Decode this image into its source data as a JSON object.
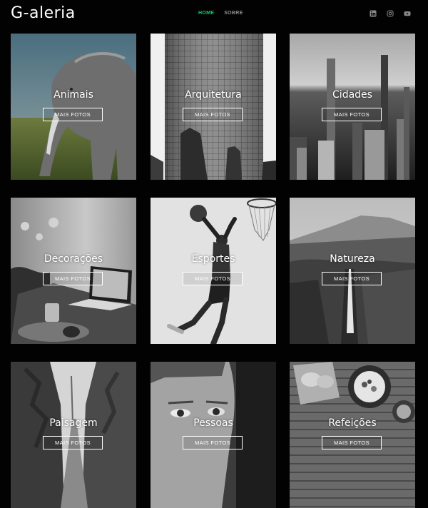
{
  "header": {
    "logo": "G-aleria",
    "nav": [
      {
        "label": "HOME",
        "active": true
      },
      {
        "label": "SOBRE",
        "active": false
      }
    ],
    "social_icons": [
      "linkedin-icon",
      "instagram-icon",
      "youtube-icon"
    ]
  },
  "gallery": {
    "button_label": "MAIS FOTOS",
    "categories": [
      {
        "title": "Animais",
        "image": "elephant-photo"
      },
      {
        "title": "Arquitetura",
        "image": "glass-building-photo"
      },
      {
        "title": "Cidades",
        "image": "city-skyline-photo"
      },
      {
        "title": "Decorações",
        "image": "laptop-desk-photo"
      },
      {
        "title": "Esportes",
        "image": "basketball-dunk-photo"
      },
      {
        "title": "Natureza",
        "image": "waterfall-mountain-photo"
      },
      {
        "title": "Paisagem",
        "image": "forest-road-photo"
      },
      {
        "title": "Pessoas",
        "image": "portrait-photo"
      },
      {
        "title": "Refeições",
        "image": "food-table-photo"
      }
    ]
  },
  "colors": {
    "background": "#020202",
    "nav_active": "#1fc46a",
    "nav_inactive": "#8f8f8f",
    "text": "#ffffff"
  }
}
